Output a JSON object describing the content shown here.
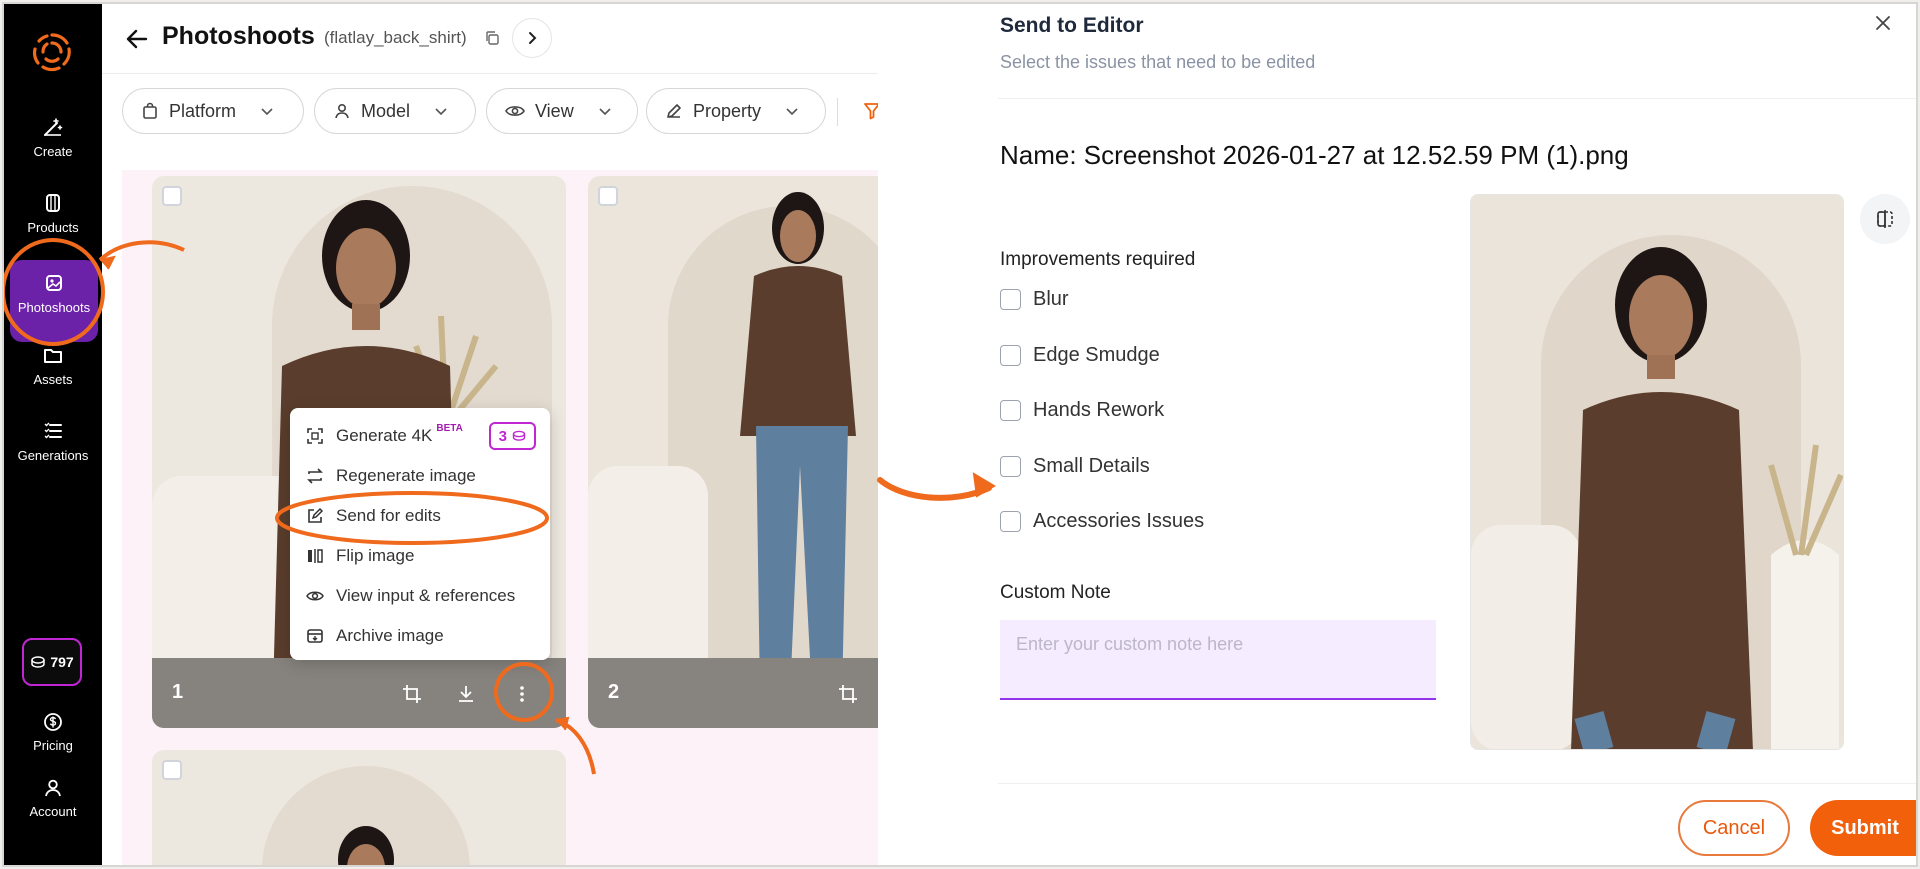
{
  "sidebar": {
    "items": [
      {
        "label": "Create",
        "icon": "create-icon"
      },
      {
        "label": "Products",
        "icon": "products-icon"
      },
      {
        "label": "Photoshoots",
        "icon": "photoshoots-icon",
        "active": true
      },
      {
        "label": "Assets",
        "icon": "folder-icon"
      },
      {
        "label": "Generations",
        "icon": "list-icon"
      },
      {
        "label": "Pricing",
        "icon": "dollar-icon"
      },
      {
        "label": "Account",
        "icon": "person-icon"
      }
    ],
    "credits": "797"
  },
  "header": {
    "title": "Photoshoots",
    "subtitle": "(flatlay_back_shirt)"
  },
  "filters": [
    "Platform",
    "Model",
    "View",
    "Property"
  ],
  "gallery": {
    "cards": [
      {
        "number": "1"
      },
      {
        "number": "2"
      }
    ]
  },
  "context_menu": {
    "items": [
      {
        "label": "Generate 4K",
        "badge": "BETA",
        "credits": "3"
      },
      {
        "label": "Regenerate image"
      },
      {
        "label": "Send for edits"
      },
      {
        "label": "Flip image"
      },
      {
        "label": "View input & references"
      },
      {
        "label": "Archive image"
      }
    ]
  },
  "modal": {
    "title": "Send to Editor",
    "subtitle": "Select the issues that need to be edited",
    "name_label": "Name: Screenshot 2026-01-27 at 12.52.59 PM (1).png",
    "section_label": "Improvements required",
    "issues": [
      "Blur",
      "Edge Smudge",
      "Hands Rework",
      "Small Details",
      "Accessories Issues"
    ],
    "note_label": "Custom Note",
    "note_placeholder": "Enter your custom note here",
    "cancel": "Cancel",
    "submit": "Submit"
  },
  "colors": {
    "accent_orange": "#f2600b",
    "active_purple": "#6b21a8",
    "annotation_orange": "#ef6a1c"
  }
}
